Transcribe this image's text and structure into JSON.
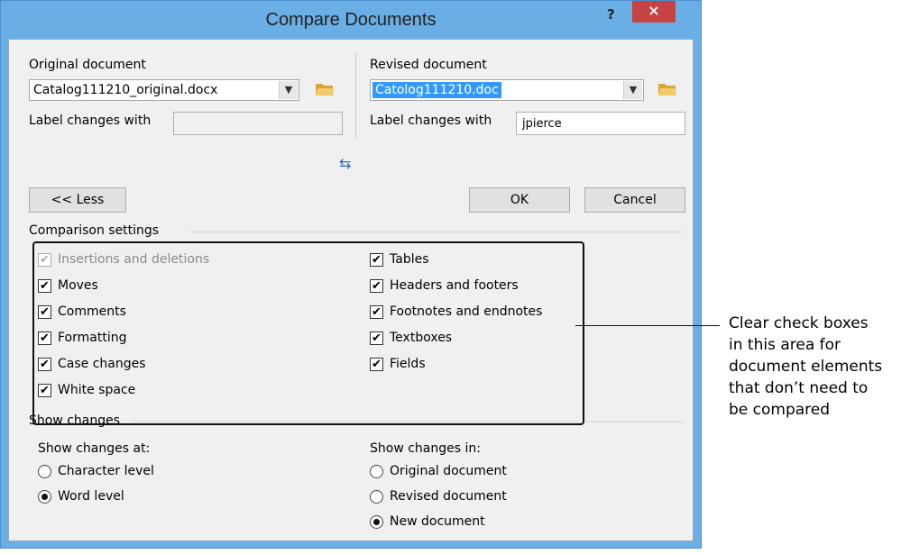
{
  "dialog": {
    "title": "Compare Documents",
    "help": "?",
    "close": "×"
  },
  "original": {
    "label": "Original document",
    "file": "Catalog111210_original.docx",
    "label_changes": "Label changes with",
    "label_value": ""
  },
  "revised": {
    "label": "Revised document",
    "file": "Catolog111210.doc",
    "label_changes": "Label changes with",
    "label_value": "jpierce"
  },
  "buttons": {
    "less": "<< Less",
    "ok": "OK",
    "cancel": "Cancel"
  },
  "comparison": {
    "heading": "Comparison settings",
    "left": [
      {
        "label": "Insertions and deletions",
        "checked": true,
        "disabled": true
      },
      {
        "label": "Moves",
        "checked": true
      },
      {
        "label": "Comments",
        "checked": true
      },
      {
        "label": "Formatting",
        "checked": true
      },
      {
        "label": "Case changes",
        "checked": true
      },
      {
        "label": "White space",
        "checked": true
      }
    ],
    "right": [
      {
        "label": "Tables",
        "checked": true
      },
      {
        "label": "Headers and footers",
        "checked": true
      },
      {
        "label": "Footnotes and endnotes",
        "checked": true
      },
      {
        "label": "Textboxes",
        "checked": true
      },
      {
        "label": "Fields",
        "checked": true
      }
    ]
  },
  "show_changes": {
    "heading": "Show changes",
    "at_label": "Show changes at:",
    "at_options": [
      {
        "label": "Character level",
        "selected": false
      },
      {
        "label": "Word level",
        "selected": true
      }
    ],
    "in_label": "Show changes in:",
    "in_options": [
      {
        "label": "Original document",
        "selected": false
      },
      {
        "label": "Revised document",
        "selected": false
      },
      {
        "label": "New document",
        "selected": true
      }
    ]
  },
  "callout": {
    "lines": [
      "Clear check boxes",
      "in this area for",
      "document elements",
      "that don’t need to",
      "be compared"
    ]
  },
  "icons": {
    "folder": "folder-open-icon",
    "swap": "swap-arrows-icon",
    "dropdown": "chevron-down-icon"
  },
  "colors": {
    "frame": "#6aaee6",
    "close": "#c74343",
    "selection": "#3399ff",
    "folder": "#e8b84a"
  }
}
